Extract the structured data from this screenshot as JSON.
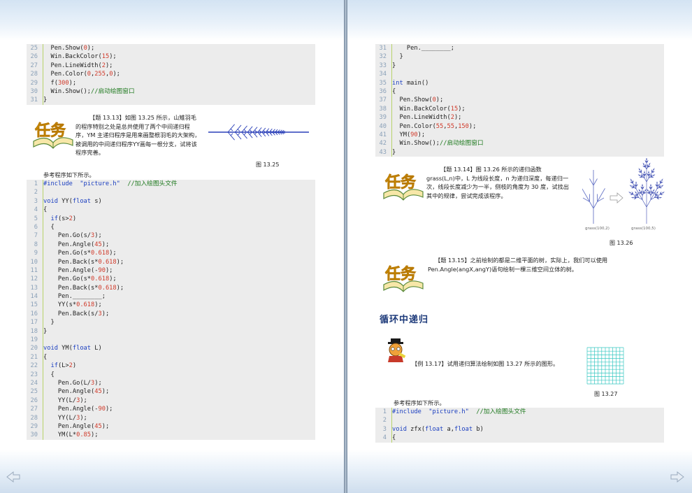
{
  "left_page": {
    "code_top": [
      {
        "n": "25",
        "t": "  Pen.Show(0);"
      },
      {
        "n": "26",
        "t": "  Win.BackColor(15);"
      },
      {
        "n": "27",
        "t": "  Pen.LineWidth(2);"
      },
      {
        "n": "28",
        "t": "  Pen.Color(0,255,0);"
      },
      {
        "n": "29",
        "t": "  f(300);"
      },
      {
        "n": "30",
        "t": "  Win.Show();//启动绘图窗口"
      },
      {
        "n": "31",
        "t": "}"
      }
    ],
    "task_badge": "任务",
    "task_text": "【题 13.13】如图 13.25 所示，山雉羽毛的程序特别之处是总共使用了两个中间递归程序，YM 主递归程序是用来画整根羽毛的大架构，被调用的中间递归程序YY画每一根分支，试将该程序完善。",
    "figure_caption": "图 13.25",
    "ref_text": "参考程序如下所示。",
    "code_main": [
      {
        "n": "1",
        "t": "#include  \"picture.h\"  //加入绘图头文件"
      },
      {
        "n": "2",
        "t": ""
      },
      {
        "n": "3",
        "t": "void YY(float s)"
      },
      {
        "n": "4",
        "t": "{"
      },
      {
        "n": "5",
        "t": "  if(s>2)"
      },
      {
        "n": "6",
        "t": "  {"
      },
      {
        "n": "7",
        "t": "    Pen.Go(s/3);"
      },
      {
        "n": "8",
        "t": "    Pen.Angle(45);"
      },
      {
        "n": "9",
        "t": "    Pen.Go(s*0.618);"
      },
      {
        "n": "10",
        "t": "    Pen.Back(s*0.618);"
      },
      {
        "n": "11",
        "t": "    Pen.Angle(-90);"
      },
      {
        "n": "12",
        "t": "    Pen.Go(s*0.618);"
      },
      {
        "n": "13",
        "t": "    Pen.Back(s*0.618);"
      },
      {
        "n": "14",
        "t": "    Pen.________;"
      },
      {
        "n": "15",
        "t": "    YY(s*0.618);"
      },
      {
        "n": "16",
        "t": "    Pen.Back(s/3);"
      },
      {
        "n": "17",
        "t": "  }"
      },
      {
        "n": "18",
        "t": "}"
      },
      {
        "n": "19",
        "t": ""
      },
      {
        "n": "20",
        "t": "void YM(float L)"
      },
      {
        "n": "21",
        "t": "{"
      },
      {
        "n": "22",
        "t": "  if(L>2)"
      },
      {
        "n": "23",
        "t": "  {"
      },
      {
        "n": "24",
        "t": "    Pen.Go(L/3);"
      },
      {
        "n": "25",
        "t": "    Pen.Angle(45);"
      },
      {
        "n": "26",
        "t": "    YY(L/3);"
      },
      {
        "n": "27",
        "t": "    Pen.Angle(-90);"
      },
      {
        "n": "28",
        "t": "    YY(L/3);"
      },
      {
        "n": "29",
        "t": "    Pen.Angle(45);"
      },
      {
        "n": "30",
        "t": "    YM(L*0.85);"
      }
    ]
  },
  "right_page": {
    "code_top": [
      {
        "n": "31",
        "t": "    Pen.________;"
      },
      {
        "n": "32",
        "t": "  }"
      },
      {
        "n": "33",
        "t": "}"
      },
      {
        "n": "34",
        "t": ""
      },
      {
        "n": "35",
        "t": "int main()"
      },
      {
        "n": "36",
        "t": "{"
      },
      {
        "n": "37",
        "t": "  Pen.Show(0);"
      },
      {
        "n": "38",
        "t": "  Win.BackColor(15);"
      },
      {
        "n": "39",
        "t": "  Pen.LineWidth(2);"
      },
      {
        "n": "40",
        "t": "  Pen.Color(55,55,150);"
      },
      {
        "n": "41",
        "t": "  YM(90);"
      },
      {
        "n": "42",
        "t": "  Win.Show();//启动绘图窗口"
      },
      {
        "n": "43",
        "t": "}"
      }
    ],
    "task1_text": "【题 13.14】图 13.26 所示的递归函数 grass(L,n)中，L 为线段长度，n 为递归深度，每递归一次，线段长度减少为一半，侧枝的角度为 30 度，试找出其中的规律，尝试完成该程序。",
    "grass_label_1": "grass(100,2)",
    "grass_label_2": "grass(100,5)",
    "figure26_caption": "图 13.26",
    "task2_text": "【题 13.15】之前绘制的都是二维平面的树，实际上，我们可以使用 Pen.Angle(angX,angY)语句绘制一棵三维空间立体的树。",
    "section_heading": "循环中递归",
    "example_text": "【例 13.17】试用递归算法绘制如图 13.27 所示的图形。",
    "figure27_caption": "图 13.27",
    "ref_text": "参考程序如下所示。",
    "code_bottom": [
      {
        "n": "1",
        "t": "#include  \"picture.h\"  //加入绘图头文件"
      },
      {
        "n": "2",
        "t": ""
      },
      {
        "n": "3",
        "t": "void zfx(float a,float b)"
      },
      {
        "n": "4",
        "t": "{"
      }
    ]
  },
  "nav": {
    "prev": "prev-page-arrow",
    "next": "next-page-arrow"
  },
  "colors": {
    "keyword": "#1a3ec0",
    "number": "#d03a2a",
    "comment": "#1f7a1f",
    "code_bg": "#ececec",
    "line_no": "#8aa0b8"
  }
}
